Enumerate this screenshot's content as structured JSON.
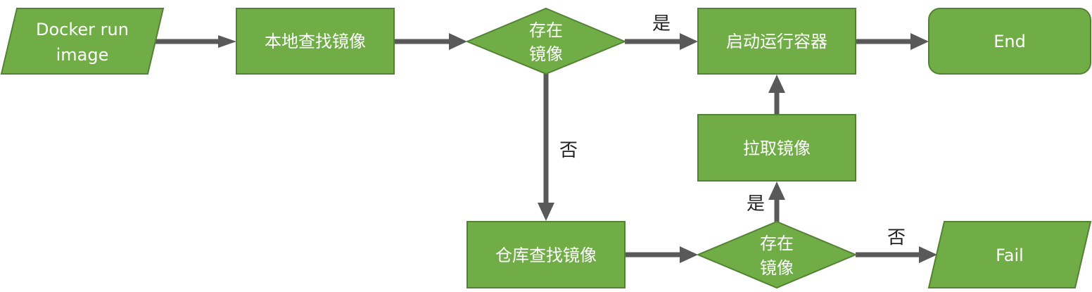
{
  "colors": {
    "node_fill": "#70ad47",
    "node_stroke": "#548235",
    "edge": "#595959",
    "node_text": "#ffffff",
    "edge_text": "#222222"
  },
  "nodes": {
    "start": {
      "line1": "Docker run",
      "line2": "image"
    },
    "local_search": {
      "label": "本地查找镜像"
    },
    "exists_local": {
      "line1": "存在",
      "line2": "镜像"
    },
    "run_container": {
      "label": "启动运行容器"
    },
    "end": {
      "label": "End"
    },
    "pull": {
      "label": "拉取镜像"
    },
    "repo_search": {
      "label": "仓库查找镜像"
    },
    "exists_repo": {
      "line1": "存在",
      "line2": "镜像"
    },
    "fail": {
      "label": "Fail"
    }
  },
  "edge_labels": {
    "local_yes": "是",
    "local_no": "否",
    "repo_yes": "是",
    "repo_no": "否"
  }
}
